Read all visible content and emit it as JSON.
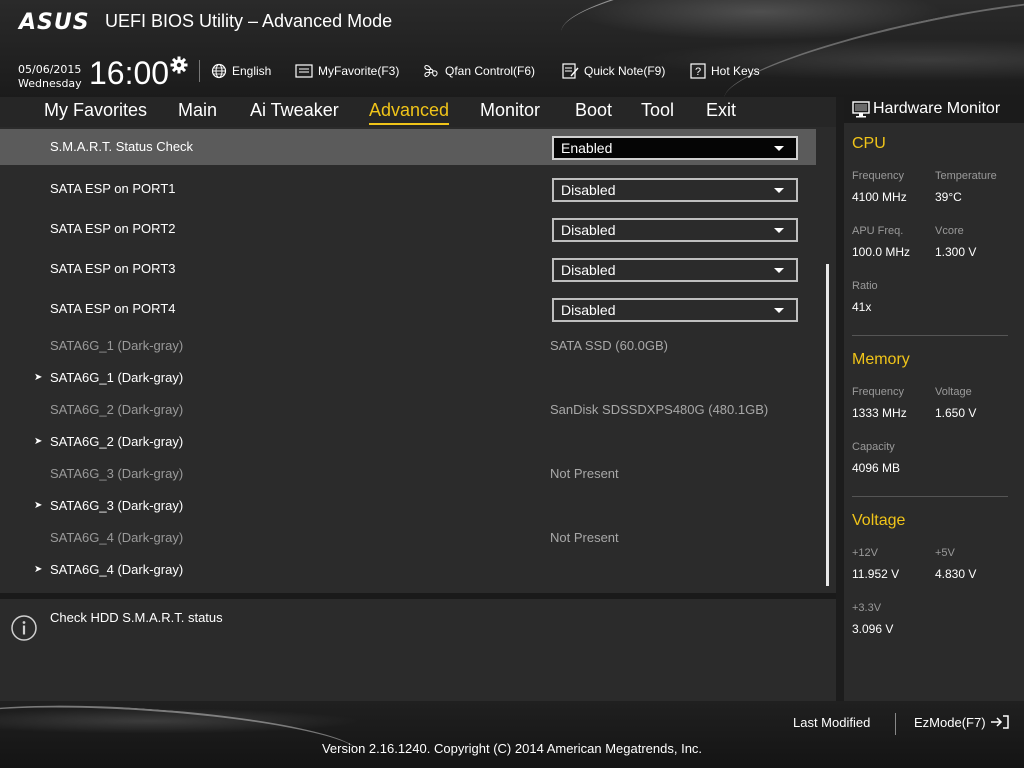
{
  "header": {
    "logo": "ASUS",
    "title": "UEFI BIOS Utility – Advanced Mode",
    "date": "05/06/2015",
    "weekday": "Wednesday",
    "time": "16:00",
    "language": "English",
    "myfavorite": "MyFavorite(F3)",
    "qfan": "Qfan Control(F6)",
    "quicknote": "Quick Note(F9)",
    "hotkeys": "Hot Keys"
  },
  "nav": {
    "tabs": [
      "My Favorites",
      "Main",
      "Ai Tweaker",
      "Advanced",
      "Monitor",
      "Boot",
      "Tool",
      "Exit"
    ],
    "active": "Advanced"
  },
  "settings": [
    {
      "label": "S.M.A.R.T. Status Check",
      "value": "Enabled",
      "kind": "dropdown",
      "selected": true
    },
    {
      "label": "SATA ESP on PORT1",
      "value": "Disabled",
      "kind": "dropdown"
    },
    {
      "label": "SATA ESP on PORT2",
      "value": "Disabled",
      "kind": "dropdown"
    },
    {
      "label": "SATA ESP on PORT3",
      "value": "Disabled",
      "kind": "dropdown"
    },
    {
      "label": "SATA ESP on PORT4",
      "value": "Disabled",
      "kind": "dropdown"
    },
    {
      "label": "SATA6G_1 (Dark-gray)",
      "value": "SATA SSD (60.0GB)",
      "kind": "info"
    },
    {
      "label": "SATA6G_1 (Dark-gray)",
      "kind": "submenu"
    },
    {
      "label": "SATA6G_2 (Dark-gray)",
      "value": "SanDisk SDSSDXPS480G (480.1GB)",
      "kind": "info"
    },
    {
      "label": "SATA6G_2 (Dark-gray)",
      "kind": "submenu"
    },
    {
      "label": "SATA6G_3 (Dark-gray)",
      "value": "Not Present",
      "kind": "info"
    },
    {
      "label": "SATA6G_3 (Dark-gray)",
      "kind": "submenu"
    },
    {
      "label": "SATA6G_4 (Dark-gray)",
      "value": "Not Present",
      "kind": "info"
    },
    {
      "label": "SATA6G_4 (Dark-gray)",
      "kind": "submenu"
    }
  ],
  "help": {
    "text": "Check HDD S.M.A.R.T. status"
  },
  "hardware_monitor": {
    "title": "Hardware Monitor",
    "cpu": {
      "heading": "CPU",
      "frequency_label": "Frequency",
      "frequency": "4100 MHz",
      "temperature_label": "Temperature",
      "temperature": "39°C",
      "apu_label": "APU Freq.",
      "apu": "100.0 MHz",
      "vcore_label": "Vcore",
      "vcore": "1.300 V",
      "ratio_label": "Ratio",
      "ratio": "41x"
    },
    "memory": {
      "heading": "Memory",
      "frequency_label": "Frequency",
      "frequency": "1333 MHz",
      "voltage_label": "Voltage",
      "voltage": "1.650 V",
      "capacity_label": "Capacity",
      "capacity": "4096 MB"
    },
    "voltage": {
      "heading": "Voltage",
      "v12_label": "+12V",
      "v12": "11.952 V",
      "v5_label": "+5V",
      "v5": "4.830 V",
      "v33_label": "+3.3V",
      "v33": "3.096 V"
    }
  },
  "footer": {
    "last_modified": "Last Modified",
    "ezmode": "EzMode(F7)",
    "version": "Version 2.16.1240. Copyright (C) 2014 American Megatrends, Inc."
  },
  "colors": {
    "accent": "#f0c419",
    "panel": "#2b2b2b",
    "selected_row": "#5b5b5b"
  }
}
